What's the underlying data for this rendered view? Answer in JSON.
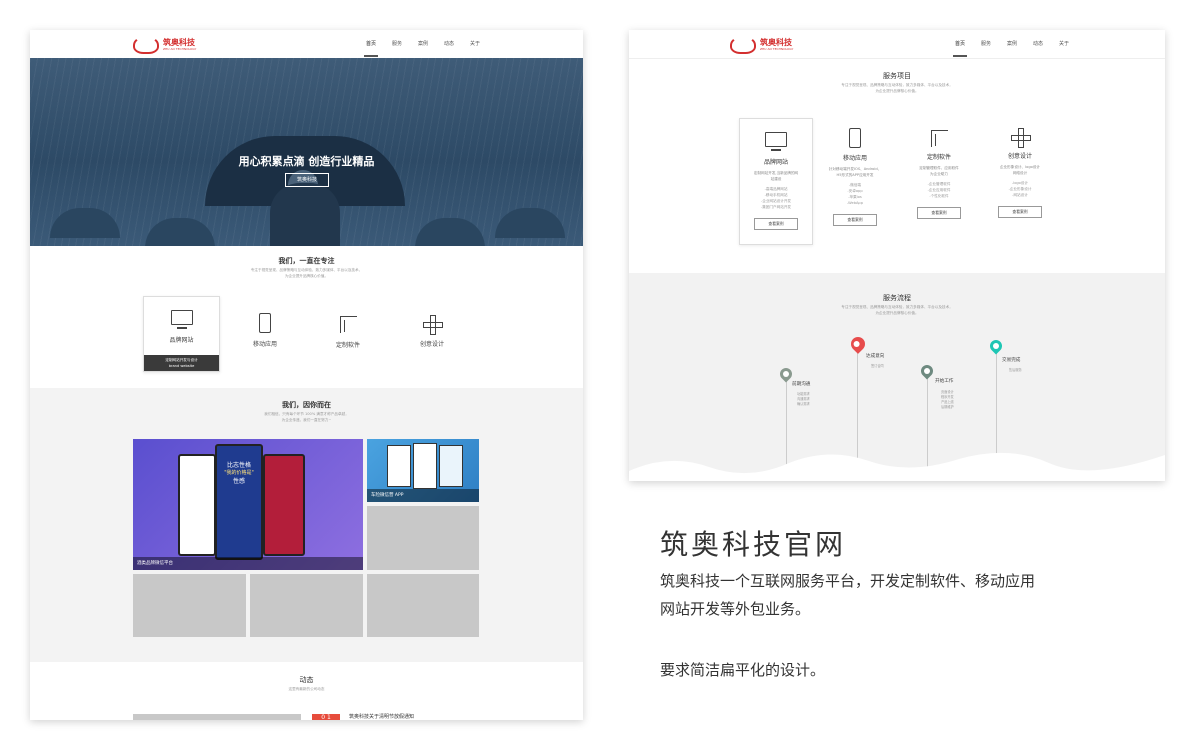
{
  "left": {
    "logo": {
      "name": "筑奥科技",
      "sub": "ZHU AO TECHNOLOGY"
    },
    "nav": [
      "首页",
      "服务",
      "案例",
      "动态",
      "关于"
    ],
    "hero": {
      "title": "用心积累点滴 创造行业精品",
      "button": "筑奥科技"
    },
    "about": {
      "title": "我们，一直在专注",
      "sub1": "专注于视觉呈现、品牌策略与互动体验，致力多媒体、平台以及技术，",
      "sub2": "为企业提升品牌核心价值。"
    },
    "services": [
      {
        "label": "品牌网站",
        "foot1": "定制网站开发与设计",
        "foot2": "brand website"
      },
      {
        "label": "移动应用"
      },
      {
        "label": "定制软件"
      },
      {
        "label": "创意设计"
      }
    ],
    "cases": {
      "title": "我们，因你而在",
      "sub1": "我们相信，只有每个环节 100% 满意才称产品卓越，",
      "sub2": "为企业传递，我们一直在努力~",
      "tiles": [
        {
          "caption": "酒类品牌微信平台"
        },
        {
          "caption": "车险微信营 APP"
        }
      ],
      "phone_text": {
        "line1": "比志性格",
        "line2": "性感",
        "line3": "\"我的价格是\""
      }
    },
    "news": {
      "title": "动态",
      "sub": "这里有最新的公司动态",
      "date": "0 1",
      "headline": "筑奥科技关于清明节放假通知"
    }
  },
  "right": {
    "logo": {
      "name": "筑奥科技",
      "sub": "ZHU AO TECHNOLOGY"
    },
    "nav": [
      "首页",
      "服务",
      "案例",
      "动态",
      "关于"
    ],
    "services": {
      "title": "服务项目",
      "sub1": "专注于视觉呈现、品牌策略与互动体验，致力多媒体、平台以及技术，",
      "sub2": "为企业提升品牌核心价值。",
      "cards": [
        {
          "name": "品牌网站",
          "desc1": "定制网站开发,当新品牌的网",
          "desc2": "站建设",
          "items": [
            "-高端品牌网站",
            "-移动手机网站",
            "-企业网站设计开发",
            "-集团门户网站开发"
          ],
          "button": "查看案例"
        },
        {
          "name": "移动应用",
          "desc1": "针对移动端开发IOS、Android、",
          "desc2": "H5形式的APP应用开发",
          "items": [
            "-微信端",
            "-安卓app",
            "-苹果ios",
            "-WebApp"
          ],
          "button": "查看案例"
        },
        {
          "name": "定制软件",
          "desc1": "定制管理软件，应用软件",
          "desc2": "为企业助力",
          "items": [
            "-企业管理软件",
            "-企业应用软件",
            "-个性化软件"
          ],
          "button": "查看案例"
        },
        {
          "name": "创意设计",
          "desc1": "企业形象设计、logo设计",
          "desc2": "网络设计",
          "items": [
            "-logo设计",
            "-企业形象设计",
            "-网站设计"
          ],
          "button": "查看案例"
        }
      ]
    },
    "process": {
      "title": "服务流程",
      "sub1": "专注于视觉呈现、品牌策略与互动体验，致力多媒体、平台以及技术，",
      "sub2": "为企业提升品牌核心价值。",
      "steps": [
        {
          "title": "前期沟通",
          "lines": [
            "功能需求",
            "沟通需求",
            "确认需求"
          ],
          "color": "#8a9a8f"
        },
        {
          "title": "达成意向",
          "lines": [
            "签订合同"
          ],
          "color": "#e74c4c"
        },
        {
          "title": "开始工作",
          "lines": [
            "页面设计",
            "程序开发",
            "产品上线",
            "后期维护"
          ],
          "color": "#6e8a80"
        },
        {
          "title": "交易完成",
          "lines": [
            "售后服务"
          ],
          "color": "#1ec6b4"
        }
      ]
    }
  },
  "description": {
    "title": "筑奥科技官网",
    "line1": "筑奥科技一个互联网服务平台，开发定制软件、移动应用",
    "line2": "网站开发等外包业务。",
    "line3": "要求简洁扁平化的设计。"
  }
}
